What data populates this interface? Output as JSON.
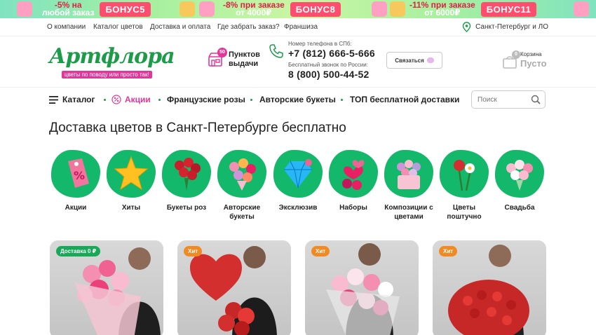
{
  "promo_banner": {
    "items": [
      {
        "line1": "-5% на",
        "line2": "любой заказ",
        "badge": "БОНУС5"
      },
      {
        "line1": "-8% при заказе",
        "line2": "от 4000₽",
        "badge": "БОНУС8"
      },
      {
        "line1": "-11% при заказе",
        "line2": "от 6000₽",
        "badge": "БОНУС11"
      }
    ]
  },
  "top_links": [
    "О компании",
    "Каталог цветов",
    "Доставка и оплата",
    "Где забрать заказ?",
    "Франшиза"
  ],
  "city": "Санкт-Петербург и ЛО",
  "logo": {
    "name": "Артфлора",
    "tagline": "цветы по поводу или просто так!"
  },
  "pickup": {
    "count": "50",
    "label_line1": "Пунктов",
    "label_line2": "выдачи"
  },
  "phones": {
    "spb_label": "Номер телефона в СПб:",
    "spb_number": "+7 (812) 666-5-666",
    "free_label": "Бесплатный звонок по России:",
    "free_number": "8 (800) 500-44-52"
  },
  "contact_button": "Связаться",
  "cart": {
    "count": "0",
    "label": "Корзина",
    "status": "Пусто"
  },
  "main_nav": {
    "catalog": "Каталог",
    "promotions": "Акции",
    "items": [
      "Французские розы",
      "Авторские букеты",
      "ТОП бесплатной доставки"
    ]
  },
  "search": {
    "placeholder": "Поиск"
  },
  "page_title": "Доставка цветов в Санкт-Петербурге бесплатно",
  "categories": [
    {
      "label": "Акции"
    },
    {
      "label": "Хиты"
    },
    {
      "label": "Букеты роз"
    },
    {
      "label": "Авторские букеты"
    },
    {
      "label": "Эксклюзив"
    },
    {
      "label": "Наборы"
    },
    {
      "label": "Композиции с цветами"
    },
    {
      "label": "Цветы поштучно"
    },
    {
      "label": "Свадьба"
    }
  ],
  "products": [
    {
      "tag": "Доставка 0 ₽"
    },
    {
      "tag": "Хит"
    },
    {
      "tag": "Хит"
    },
    {
      "tag": "Хит"
    }
  ],
  "colors": {
    "brand_green": "#1e9b4a",
    "accent_pink": "#e0379a",
    "category_green": "#14b86a",
    "hit_orange": "#f08a24"
  }
}
